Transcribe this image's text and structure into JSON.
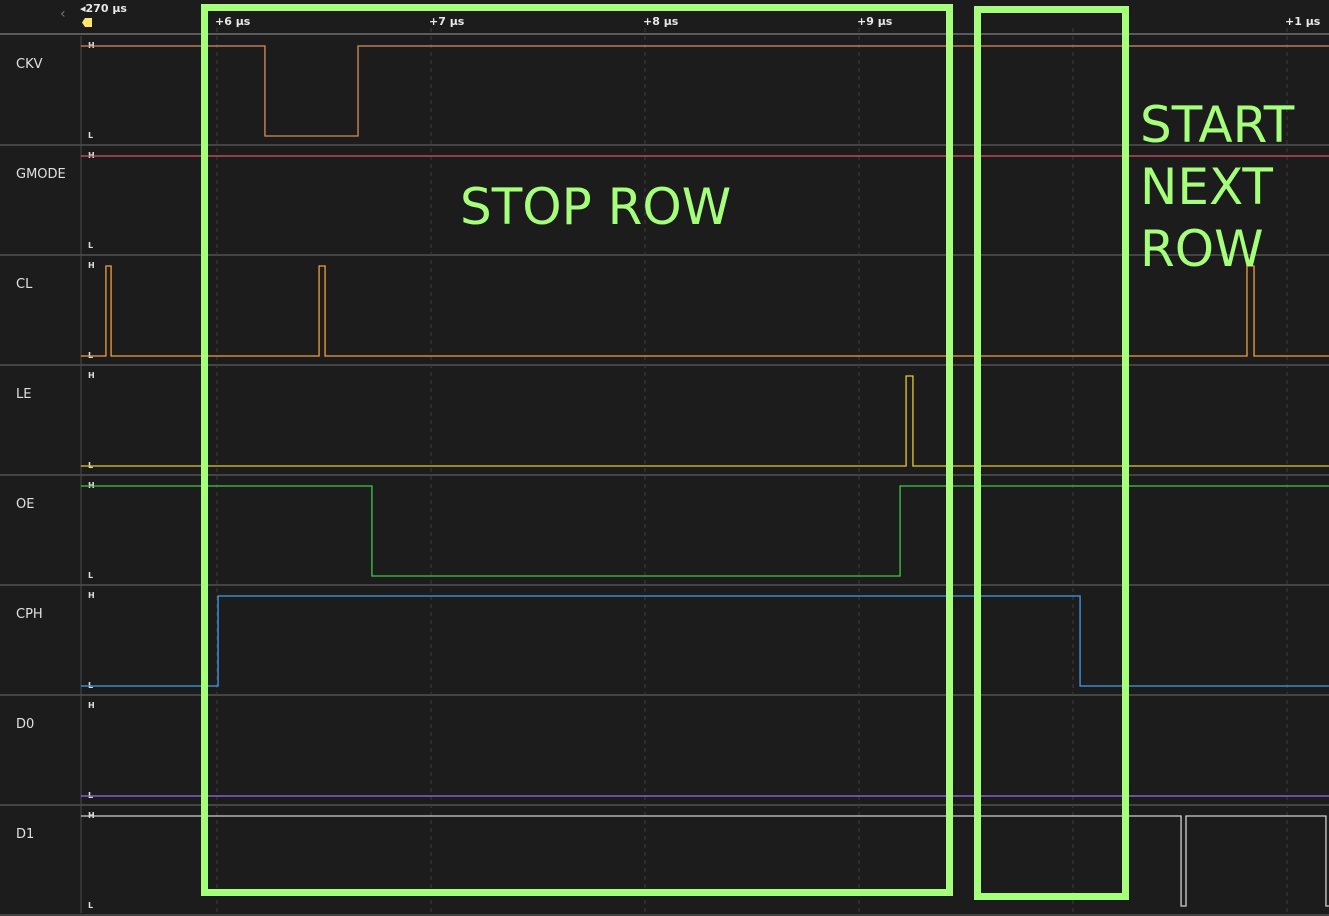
{
  "ruler": {
    "marker_label": "◂270 µs",
    "ticks": [
      {
        "t": 6,
        "label": "+6 µs"
      },
      {
        "t": 7,
        "label": "+7 µs"
      },
      {
        "t": 8,
        "label": "+8 µs"
      },
      {
        "t": 9,
        "label": "+9 µs"
      },
      {
        "t": 10,
        "label": ""
      },
      {
        "t": 11,
        "label": "+1 µs"
      }
    ]
  },
  "time_range_us": [
    5.364,
    11.196
  ],
  "level_high": "H",
  "level_low": "L",
  "channels": [
    {
      "name": "CKV",
      "color": "#d98a5f",
      "initial": 1,
      "edges": [
        6.224,
        6.659
      ]
    },
    {
      "name": "GMODE",
      "color": "#e0506a",
      "initial": 1,
      "edges": []
    },
    {
      "name": "CL",
      "color": "#f0a040",
      "initial": 0,
      "edges": [
        5.481,
        5.505,
        6.477,
        6.505,
        10.813,
        10.846
      ]
    },
    {
      "name": "LE",
      "color": "#e6c830",
      "initial": 0,
      "edges": [
        9.22,
        9.252
      ]
    },
    {
      "name": "OE",
      "color": "#3fc84a",
      "initial": 1,
      "edges": [
        6.724,
        9.192
      ]
    },
    {
      "name": "CPH",
      "color": "#3f9cf0",
      "initial": 0,
      "edges": [
        6.005,
        10.033
      ]
    },
    {
      "name": "D0",
      "color": "#9a6cf0",
      "initial": 0,
      "edges": []
    },
    {
      "name": "D1",
      "color": "#d0d0d0",
      "initial": 1,
      "edges": [
        10.505,
        10.528,
        11.182
      ]
    }
  ],
  "annotations": {
    "color": "#a6ff7a",
    "stop_row": "STOP ROW",
    "start_next_row": [
      "START",
      "NEXT",
      "ROW"
    ]
  }
}
